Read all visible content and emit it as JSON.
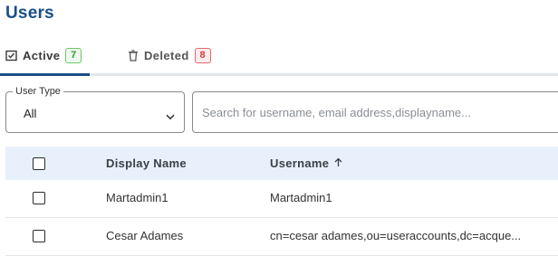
{
  "page": {
    "title": "Users"
  },
  "tabs": [
    {
      "label": "Active",
      "count": "7",
      "icon": "checkbox-check-icon"
    },
    {
      "label": "Deleted",
      "count": "8",
      "icon": "trash-icon"
    }
  ],
  "filters": {
    "user_type": {
      "label": "User Type",
      "value": "All"
    },
    "search": {
      "placeholder": "Search for username, email address,displayname..."
    }
  },
  "table": {
    "columns": {
      "display_name": "Display Name",
      "username": "Username"
    },
    "sort": {
      "column": "username",
      "direction": "ascending"
    },
    "rows": [
      {
        "display_name": "Martadmin1",
        "username": "Martadmin1"
      },
      {
        "display_name": "Cesar Adames",
        "username": "cn=cesar adames,ou=useraccounts,dc=acque..."
      }
    ]
  },
  "colors": {
    "accent": "#1a4f86",
    "active_badge": "#2f9a2f",
    "deleted_badge": "#d43b3b",
    "header_bg": "#e8f1fb"
  }
}
